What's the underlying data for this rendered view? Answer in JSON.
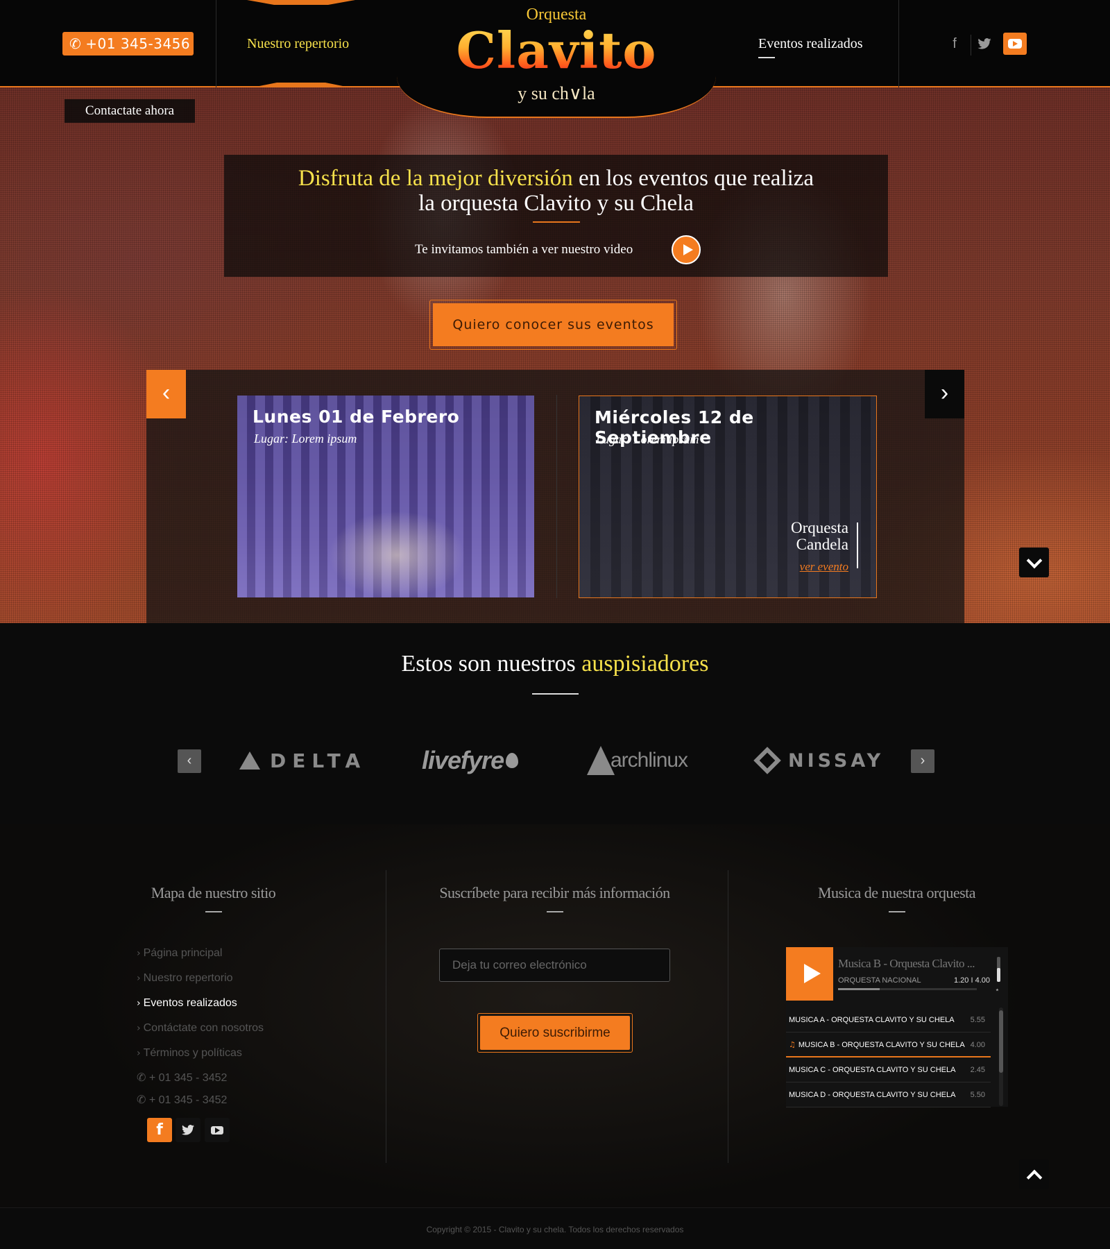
{
  "header": {
    "phone": "+01 345-3456",
    "nav_repertorio": "Nuestro repertorio",
    "nav_eventos": "Eventos realizados",
    "logo_top": "Orquesta",
    "logo_main": "Clavito",
    "logo_sub": "y su ch∨la",
    "social": [
      "facebook-icon",
      "twitter-icon",
      "youtube-icon"
    ]
  },
  "hero": {
    "contact_now": "Contactate ahora",
    "headline_highlight": "Disfruta de la mejor diversión",
    "headline_rest": " en los eventos que realiza",
    "headline_line2": "la orquesta Clavito y su Chela",
    "video_text": "Te invitamos también a ver nuestro video",
    "cta": "Quiero conocer sus eventos"
  },
  "events": [
    {
      "date": "Lunes 01 de Febrero",
      "place": "Lugar: Lorem ipsum"
    },
    {
      "date": "Miércoles 12 de Septiembre",
      "place": "Lugar: Lorem ipsum",
      "band_line1": "Orquesta",
      "band_line2": "Candela",
      "link": "ver evento"
    }
  ],
  "sponsors": {
    "title_plain": "Estos son nuestros ",
    "title_highlight": "auspisiadores",
    "logos": [
      "DELTA",
      "livefyre",
      "archlinux",
      "NISSAY"
    ]
  },
  "footer": {
    "sitemap_title": "Mapa de nuestro sitio",
    "sitemap_items": [
      "Página principal",
      "Nuestro repertorio",
      "Eventos realizados",
      "Contáctate con nosotros",
      "Términos y políticas"
    ],
    "phones": [
      "+ 01 345 - 3452",
      "+ 01 345 - 3452"
    ],
    "subscribe_title": "Suscríbete para recibir más información",
    "email_placeholder": "Deja tu correo electrónico",
    "subscribe_button": "Quiero suscribirme",
    "music_title": "Musica de nuestra orquesta",
    "player": {
      "now_playing": "Musica B - Orquesta Clavito ...",
      "artist": "ORQUESTA NACIONAL",
      "time": "1.20 I 4.00",
      "progress": 0.3,
      "volume": 0.55
    },
    "tracks": [
      {
        "title": "MUSICA A - ORQUESTA CLAVITO Y SU CHELA",
        "duration": "5.55"
      },
      {
        "title": "MUSICA B - ORQUESTA CLAVITO Y SU CHELA",
        "duration": "4.00"
      },
      {
        "title": "MUSICA C - ORQUESTA CLAVITO Y SU CHELA",
        "duration": "2.45"
      },
      {
        "title": "MUSICA D - ORQUESTA CLAVITO Y SU CHELA",
        "duration": "5.50"
      }
    ],
    "copyright": "Copyright © 2015 - Clavito y su chela. Todos los derechos reservados"
  },
  "colors": {
    "accent": "#f47c20",
    "highlight": "#f6e14b",
    "background": "#0b0b0b"
  }
}
